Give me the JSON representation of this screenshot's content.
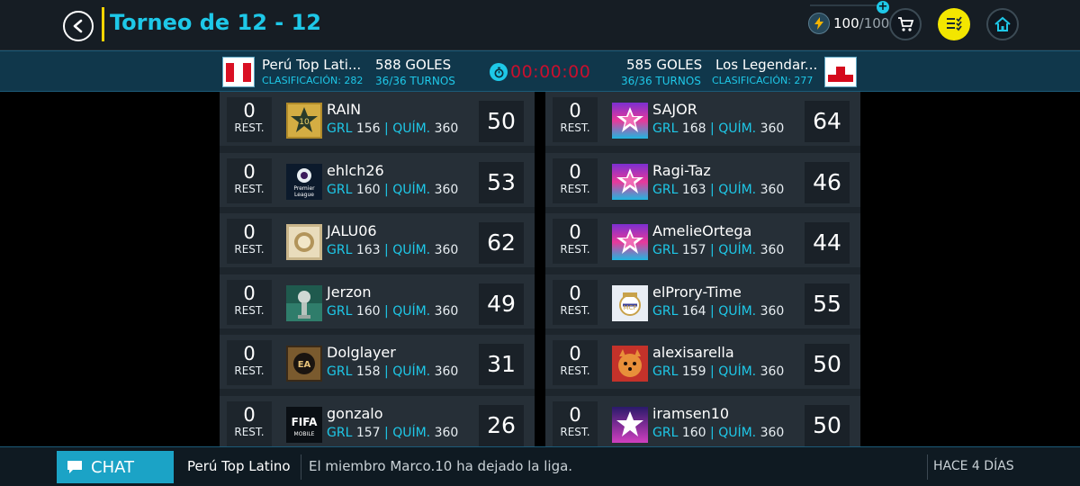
{
  "header": {
    "title": "Torneo de 12 - 12",
    "currency_value": "100",
    "currency_max": "/100"
  },
  "match": {
    "home": {
      "name": "Perú Top Lati...",
      "classification": "CLASIFICACIÓN: 282",
      "goals": "588 GOLES",
      "turns": "36/36 TURNOS",
      "flag": "peru-flag"
    },
    "away": {
      "name": "Los Legendar...",
      "classification": "CLASIFICACIÓN: 277",
      "goals": "585 GOLES",
      "turns": "36/36 TURNOS",
      "flag": "gibraltar-flag"
    },
    "timer": "00:00:00"
  },
  "labels": {
    "rest": "REST.",
    "grl": "GRL",
    "quim": "QUÍM."
  },
  "home_players": [
    {
      "rest": "0",
      "name": "RAIN",
      "grl": "156",
      "quim": "360",
      "score": "50",
      "badge": "gold-star-10-badge"
    },
    {
      "rest": "0",
      "name": "ehlch26",
      "grl": "160",
      "quim": "360",
      "score": "53",
      "badge": "premier-league-badge"
    },
    {
      "rest": "0",
      "name": "JALU06",
      "grl": "163",
      "quim": "360",
      "score": "62",
      "badge": "icon-badge"
    },
    {
      "rest": "0",
      "name": "Jerzon",
      "grl": "160",
      "quim": "360",
      "score": "49",
      "badge": "trophy-badge"
    },
    {
      "rest": "0",
      "name": "Dolglayer",
      "grl": "158",
      "quim": "360",
      "score": "31",
      "badge": "ea-sports-badge"
    },
    {
      "rest": "0",
      "name": "gonzalo",
      "grl": "157",
      "quim": "360",
      "score": "26",
      "badge": "fifa-mobile-badge"
    }
  ],
  "away_players": [
    {
      "rest": "0",
      "name": "SAJOR",
      "grl": "168",
      "quim": "360",
      "score": "64",
      "badge": "pink-star-badge"
    },
    {
      "rest": "0",
      "name": "Ragi-Taz",
      "grl": "163",
      "quim": "360",
      "score": "46",
      "badge": "pink-star-badge"
    },
    {
      "rest": "0",
      "name": "AmelieOrtega",
      "grl": "157",
      "quim": "360",
      "score": "44",
      "badge": "pink-star-badge"
    },
    {
      "rest": "0",
      "name": "elProry-Time",
      "grl": "164",
      "quim": "360",
      "score": "55",
      "badge": "real-madrid-badge"
    },
    {
      "rest": "0",
      "name": "alexisarella",
      "grl": "159",
      "quim": "360",
      "score": "50",
      "badge": "dog-avatar-badge"
    },
    {
      "rest": "0",
      "name": "iramsen10",
      "grl": "160",
      "quim": "360",
      "score": "50",
      "badge": "purple-star-badge"
    }
  ],
  "chat": {
    "button_label": "CHAT",
    "league": "Perú Top Latino",
    "message": "El miembro Marco.10 ha dejado la liga.",
    "time": "HACE 4 DÍAS"
  },
  "colors": {
    "accent": "#1ec8e8",
    "timer": "#c8102e",
    "highlight": "#f3e600"
  }
}
